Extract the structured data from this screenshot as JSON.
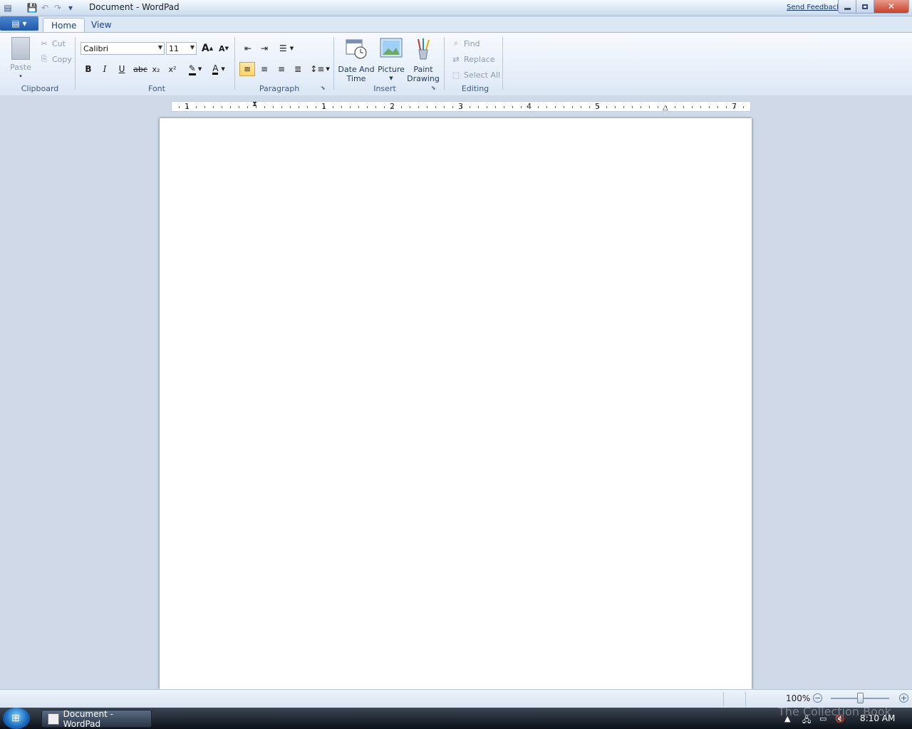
{
  "window": {
    "title": "Document - WordPad",
    "send_feedback": "Send Feedback"
  },
  "tabs": [
    {
      "label": "Home",
      "active": true
    },
    {
      "label": "View",
      "active": false
    }
  ],
  "clipboard": {
    "paste": "Paste",
    "cut": "Cut",
    "copy": "Copy",
    "group_label": "Clipboard"
  },
  "font": {
    "family": "Calibri",
    "size": "11",
    "group_label": "Font",
    "bold": "B",
    "italic": "I",
    "underline": "U",
    "strikethrough": "abc",
    "subscript": "x₂",
    "superscript": "x²",
    "grow": "A",
    "shrink": "A",
    "text_color": "A"
  },
  "paragraph": {
    "group_label": "Paragraph"
  },
  "insert": {
    "date_time_line1": "Date And",
    "date_time_line2": "Time",
    "picture": "Picture",
    "paint_line1": "Paint",
    "paint_line2": "Drawing",
    "group_label": "Insert"
  },
  "editing": {
    "find": "Find",
    "replace": "Replace",
    "select_all": "Select All",
    "group_label": "Editing"
  },
  "ruler": {
    "labels": [
      "1",
      "1",
      "2",
      "3",
      "4",
      "5",
      "7"
    ]
  },
  "statusbar": {
    "zoom": "100%"
  },
  "taskbar": {
    "task_item": "Document - WordPad",
    "watermark": "The Collection Book",
    "clock": "8:10 AM"
  }
}
